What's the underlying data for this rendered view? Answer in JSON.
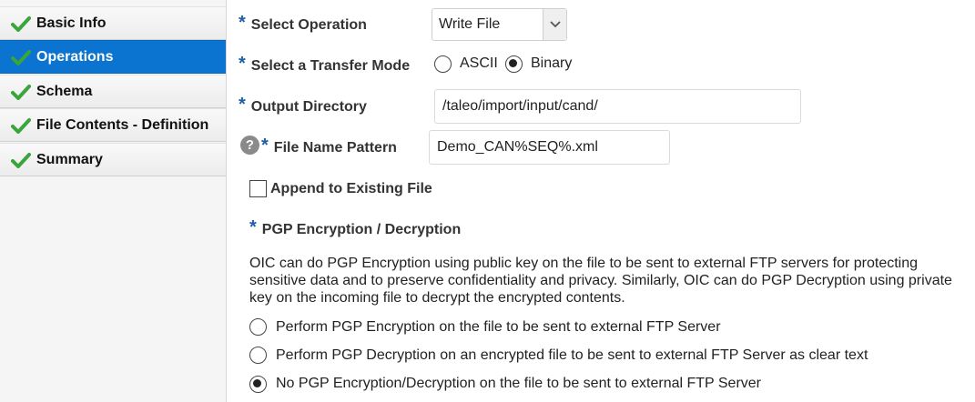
{
  "sidebar": {
    "items": [
      {
        "label": "Basic Info",
        "active": false
      },
      {
        "label": "Operations",
        "active": true
      },
      {
        "label": "Schema",
        "active": false
      },
      {
        "label": "File Contents - Definition",
        "active": false
      },
      {
        "label": "Summary",
        "active": false
      }
    ]
  },
  "form": {
    "required_marker": "*",
    "select_operation": {
      "label": "Select Operation",
      "value": "Write File"
    },
    "transfer_mode": {
      "label": "Select a Transfer Mode",
      "options": [
        {
          "label": "ASCII",
          "selected": false
        },
        {
          "label": "Binary",
          "selected": true
        }
      ]
    },
    "output_directory": {
      "label": "Output Directory",
      "value": "/taleo/import/input/cand/"
    },
    "file_name_pattern": {
      "label": "File Name Pattern",
      "value": "Demo_CAN%SEQ%.xml",
      "help_glyph": "?"
    },
    "append": {
      "label": "Append to Existing File",
      "checked": false
    },
    "pgp": {
      "label": "PGP Encryption / Decryption",
      "description_lines": [
        "OIC can do PGP Encryption using public key on the file to be sent to external FTP servers for protecting",
        "sensitive data and to preserve confidentiality and privacy. Similarly, OIC can do PGP Decryption using private",
        "key on the incoming file to decrypt the encrypted contents."
      ],
      "options": [
        {
          "label": "Perform PGP Encryption on the file to be sent to external FTP Server",
          "selected": false
        },
        {
          "label": "Perform PGP Decryption on an encrypted file to be sent to external FTP Server as clear text",
          "selected": false
        },
        {
          "label": "No PGP Encryption/Decryption on the file to be sent to external FTP Server",
          "selected": true
        }
      ]
    }
  },
  "colors": {
    "accent": "#0b73d0",
    "check_green": "#3aa53a",
    "required_blue": "#1c5fa6"
  },
  "icons": {
    "nav_check": "check-icon",
    "select_chevron": "chevron-down-icon",
    "help": "help-icon"
  }
}
